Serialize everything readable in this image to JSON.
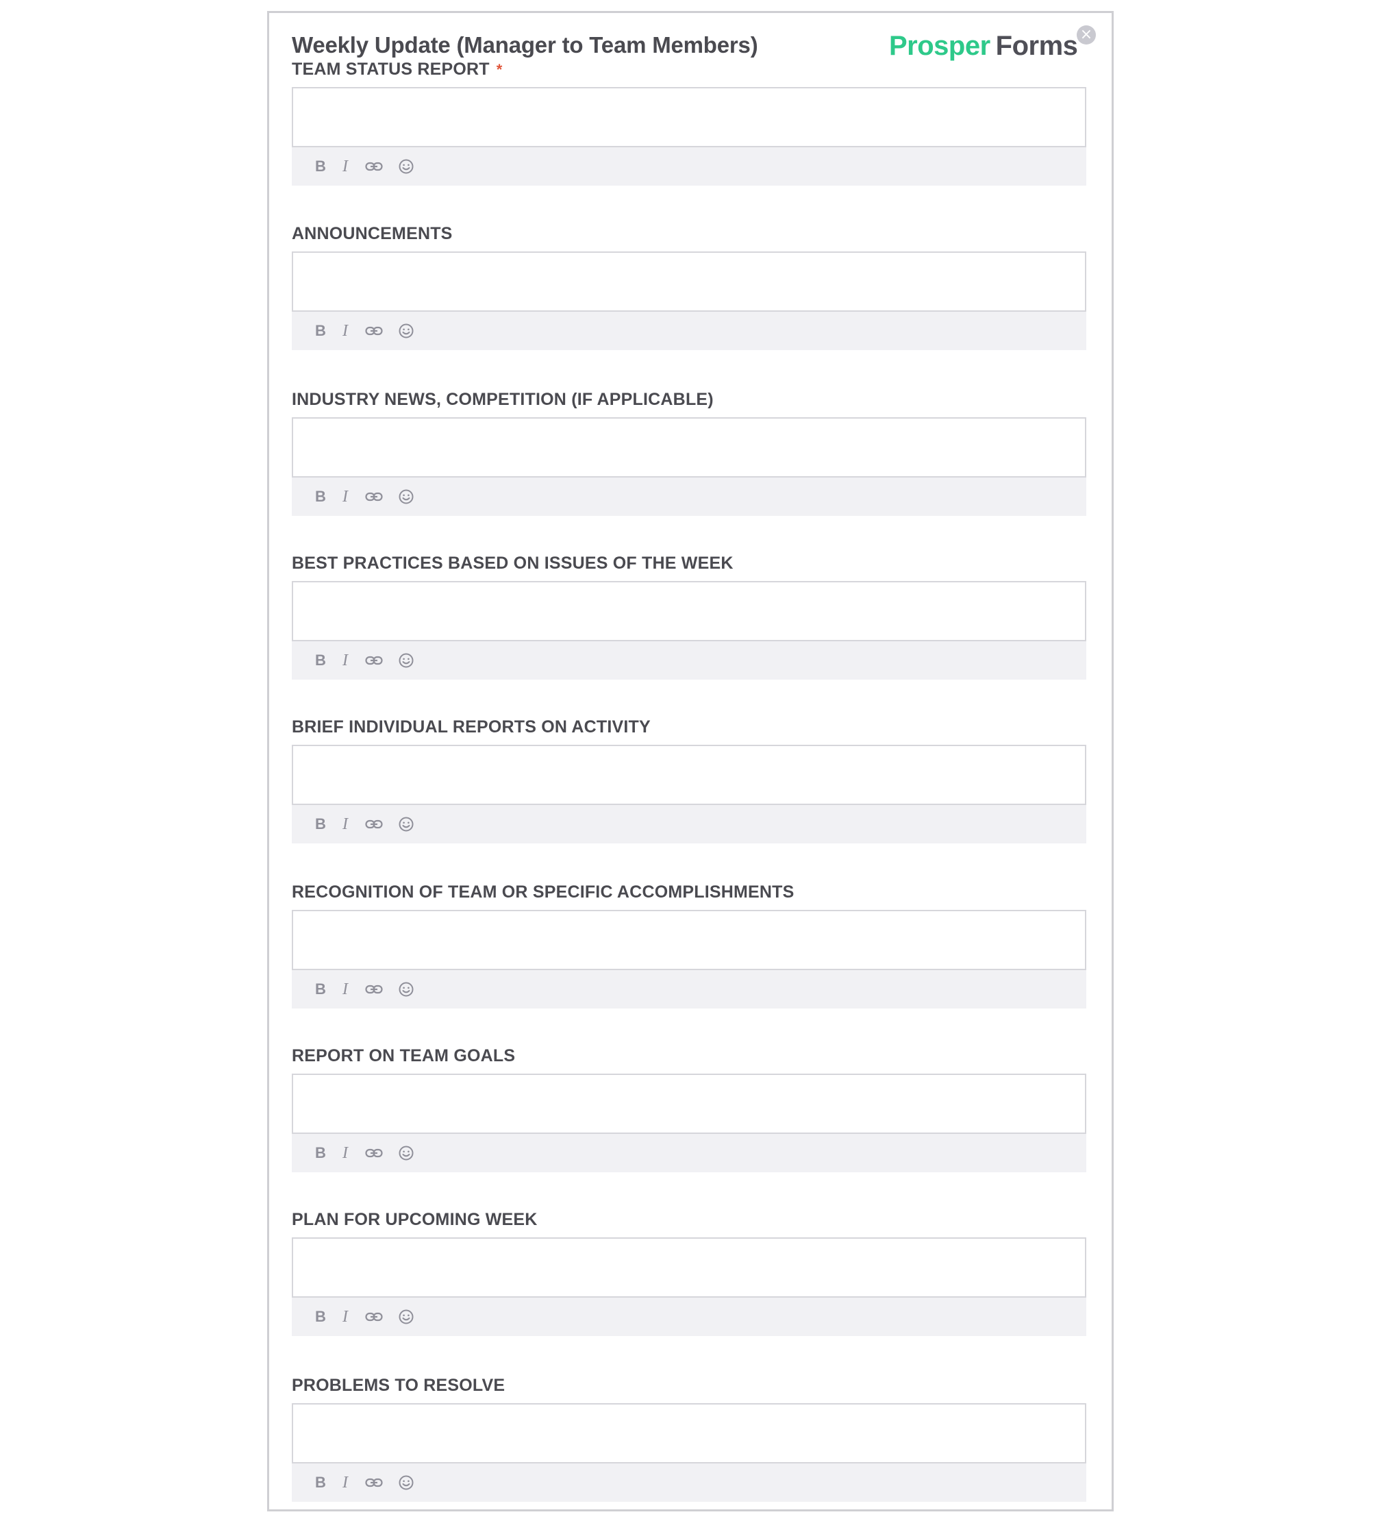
{
  "form": {
    "title": "Weekly Update (Manager to Team Members)",
    "close_icon": "close-icon",
    "close_glyph": "×",
    "logo": {
      "part1": "Prosper",
      "part2": "Forms",
      "part1_color": "#2ec98a",
      "part2_color": "#4f4f57"
    },
    "required_marker": "*",
    "toolbar": {
      "bold_icon": "bold-icon",
      "bold_glyph": "B",
      "italic_icon": "italic-icon",
      "italic_glyph": "I",
      "link_icon": "link-icon",
      "emoji_icon": "emoji-icon"
    },
    "fields": [
      {
        "label": "TEAM STATUS REPORT",
        "required": true,
        "value": ""
      },
      {
        "label": "ANNOUNCEMENTS",
        "required": false,
        "value": ""
      },
      {
        "label": "INDUSTRY NEWS, COMPETITION (IF APPLICABLE)",
        "required": false,
        "value": ""
      },
      {
        "label": "BEST PRACTICES BASED ON ISSUES OF THE WEEK",
        "required": false,
        "value": ""
      },
      {
        "label": "BRIEF INDIVIDUAL REPORTS ON ACTIVITY",
        "required": false,
        "value": ""
      },
      {
        "label": "RECOGNITION OF TEAM OR SPECIFIC ACCOMPLISHMENTS",
        "required": false,
        "value": ""
      },
      {
        "label": "REPORT ON TEAM GOALS",
        "required": false,
        "value": ""
      },
      {
        "label": "PLAN FOR UPCOMING WEEK",
        "required": false,
        "value": ""
      },
      {
        "label": "PROBLEMS TO RESOLVE",
        "required": false,
        "value": ""
      }
    ]
  }
}
